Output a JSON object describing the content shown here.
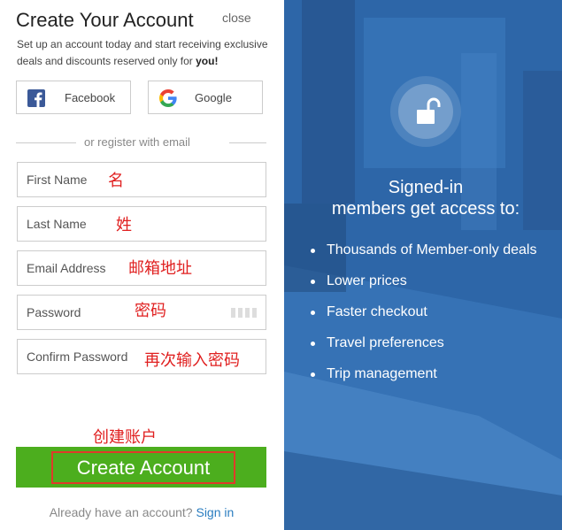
{
  "header": {
    "title": "Create Your Account",
    "close_label": "close",
    "subtitle_prefix": "Set up an account today and start receiving exclusive deals and discounts reserved only for ",
    "subtitle_bold": "you!"
  },
  "social": {
    "facebook_label": "Facebook",
    "google_label": "Google",
    "divider_text": "or register with email"
  },
  "form": {
    "first_name_placeholder": "First Name",
    "last_name_placeholder": "Last Name",
    "email_placeholder": "Email Address",
    "password_placeholder": "Password",
    "confirm_password_placeholder": "Confirm Password"
  },
  "annotations": {
    "first_name": "名",
    "last_name": "姓",
    "email": "邮箱地址",
    "password": "密码",
    "confirm_password": "再次输入密码",
    "create_account": "创建账户"
  },
  "actions": {
    "create_account_label": "Create Account",
    "signin_prompt": "Already have an account?",
    "signin_link": "Sign in"
  },
  "promo": {
    "title_line1": "Signed-in",
    "title_line2": "members get access to:",
    "benefits": [
      "Thousands of Member-only deals",
      "Lower prices",
      "Faster checkout",
      "Travel preferences",
      "Trip management"
    ]
  },
  "colors": {
    "create_button": "#4cae1e",
    "annotation_red": "#e02020",
    "signin_link": "#2a7dc0",
    "promo_bg": "#2e67aa"
  }
}
